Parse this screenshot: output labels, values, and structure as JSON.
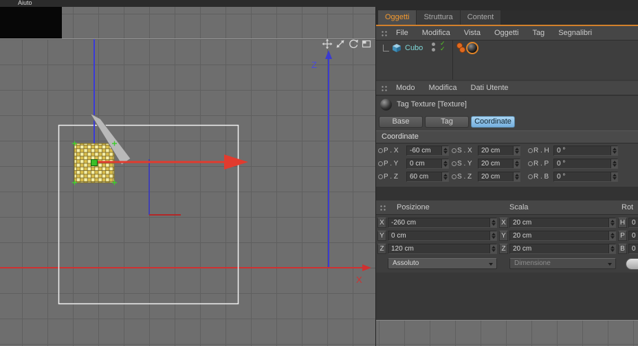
{
  "app": {
    "menu_help": "Aiuto"
  },
  "viewport": {
    "z_axis_label": "Z",
    "x_axis_label": "X"
  },
  "object_manager": {
    "tabs": [
      {
        "label": "Oggetti"
      },
      {
        "label": "Struttura"
      },
      {
        "label": "Content"
      }
    ],
    "menu_items": [
      {
        "label": "File"
      },
      {
        "label": "Modifica"
      },
      {
        "label": "Vista"
      },
      {
        "label": "Oggetti"
      },
      {
        "label": "Tag"
      },
      {
        "label": "Segnalibri"
      }
    ],
    "object": {
      "name": "Cubo"
    }
  },
  "attribute_manager": {
    "menu_items": [
      {
        "label": "Modo"
      },
      {
        "label": "Modifica"
      },
      {
        "label": "Dati Utente"
      }
    ],
    "title": "Tag Texture [Texture]",
    "tabs": [
      {
        "label": "Base"
      },
      {
        "label": "Tag"
      },
      {
        "label": "Coordinate"
      }
    ],
    "active_tab": "Coordinate",
    "section_title": "Coordinate",
    "rows": [
      {
        "p_label": "P . X",
        "p_value": "-60 cm",
        "s_label": "S . X",
        "s_value": "20 cm",
        "r_label": "R . H",
        "r_value": "0 °"
      },
      {
        "p_label": "P . Y",
        "p_value": "0 cm",
        "s_label": "S . Y",
        "s_value": "20 cm",
        "r_label": "R . P",
        "r_value": "0 °"
      },
      {
        "p_label": "P . Z",
        "p_value": "60 cm",
        "s_label": "S . Z",
        "s_value": "20 cm",
        "r_label": "R . B",
        "r_value": "0 °"
      }
    ]
  },
  "coordinate_manager": {
    "col_headers": [
      {
        "label": "Posizione"
      },
      {
        "label": "Scala"
      },
      {
        "label": "Rot"
      }
    ],
    "rows": [
      {
        "axis": "X",
        "position": "-260 cm",
        "scale_axis": "X",
        "scale": "20 cm",
        "rot_axis": "H",
        "rot": "0"
      },
      {
        "axis": "Y",
        "position": "0 cm",
        "scale_axis": "Y",
        "scale": "20 cm",
        "rot_axis": "P",
        "rot": "0"
      },
      {
        "axis": "Z",
        "position": "120 cm",
        "scale_axis": "Z",
        "scale": "20 cm",
        "rot_axis": "B",
        "rot": "0"
      }
    ],
    "mode_select": "Assoluto",
    "size_select": "Dimensione"
  }
}
